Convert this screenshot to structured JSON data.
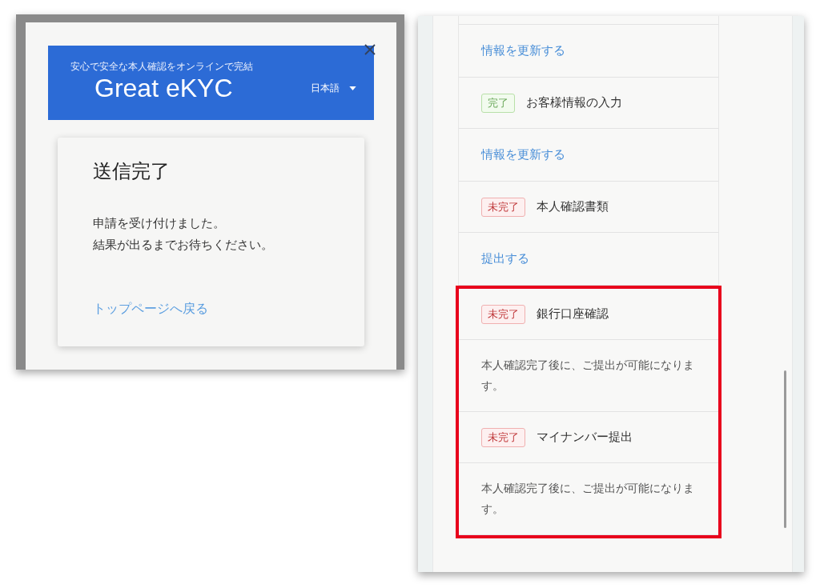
{
  "modal": {
    "header": {
      "tagline": "安心で安全な本人確認をオンラインで完結",
      "brand": "Great eKYC",
      "language": "日本語"
    },
    "card": {
      "title": "送信完了",
      "message_lines": [
        "申請を受け付けました。",
        "結果が出るまでお待ちください。"
      ],
      "link": "トップページへ戻る"
    }
  },
  "steps": [
    {
      "kind": "link",
      "text": "情報を更新する"
    },
    {
      "kind": "status",
      "complete": true,
      "badge": "完了",
      "text": "お客様情報の入力"
    },
    {
      "kind": "link",
      "text": "情報を更新する"
    },
    {
      "kind": "status",
      "complete": false,
      "badge": "未完了",
      "text": "本人確認書類"
    },
    {
      "kind": "link",
      "text": "提出する"
    }
  ],
  "highlighted_steps": [
    {
      "kind": "status",
      "complete": false,
      "badge": "未完了",
      "text": "銀行口座確認"
    },
    {
      "kind": "note",
      "text": "本人確認完了後に、ご提出が可能になります。"
    },
    {
      "kind": "status",
      "complete": false,
      "badge": "未完了",
      "text": "マイナンバー提出"
    },
    {
      "kind": "note",
      "text": "本人確認完了後に、ご提出が可能になります。"
    }
  ]
}
